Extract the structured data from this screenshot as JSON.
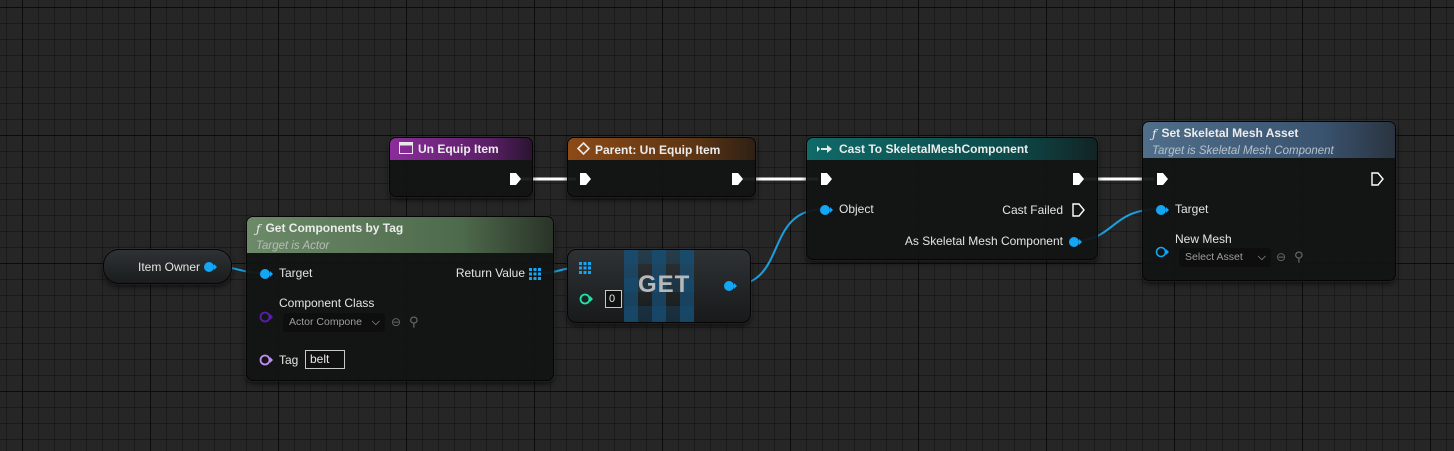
{
  "nodes": {
    "un_equip_item": {
      "title": "Un Equip Item"
    },
    "parent_un_equip_item": {
      "title": "Parent: Un Equip Item"
    },
    "cast_to": {
      "title": "Cast To SkeletalMeshComponent",
      "object_pin": "Object",
      "cast_failed_pin": "Cast Failed",
      "as_pin": "As Skeletal Mesh Component"
    },
    "set_skeletal_mesh": {
      "title": "Set Skeletal Mesh Asset",
      "subtitle": "Target is Skeletal Mesh Component",
      "target_pin": "Target",
      "new_mesh_pin": "New Mesh",
      "new_mesh_value": "Select Asset"
    },
    "get_components_by_tag": {
      "title": "Get Components by Tag",
      "subtitle": "Target is Actor",
      "target_pin": "Target",
      "return_pin": "Return Value",
      "component_class_pin": "Component Class",
      "component_class_value": "Actor Compone",
      "tag_pin": "Tag",
      "tag_value": "belt"
    },
    "item_owner": {
      "label": "Item Owner"
    },
    "get": {
      "label": "GET",
      "index_value": "0"
    }
  },
  "icons": {
    "event": "event-icon",
    "parent": "parent-call-icon",
    "cast": "cast-icon",
    "function": "function-icon",
    "browse": "browse-arrow-icon",
    "search": "search-icon"
  },
  "colors": {
    "event_header": "#8a2d9a",
    "parent_header": "#8c4a16",
    "cast_header": "#0f5f5e",
    "function_header_green": "#6c8a68",
    "function_header_blue": "#4f6e8a",
    "object_pin": "#12a6f5",
    "class_pin": "#5a1fa8",
    "name_pin": "#c08ff0",
    "integer_pin": "#1fe3a8",
    "wire_object": "#1ba1e2",
    "wire_exec": "#ffffff"
  }
}
